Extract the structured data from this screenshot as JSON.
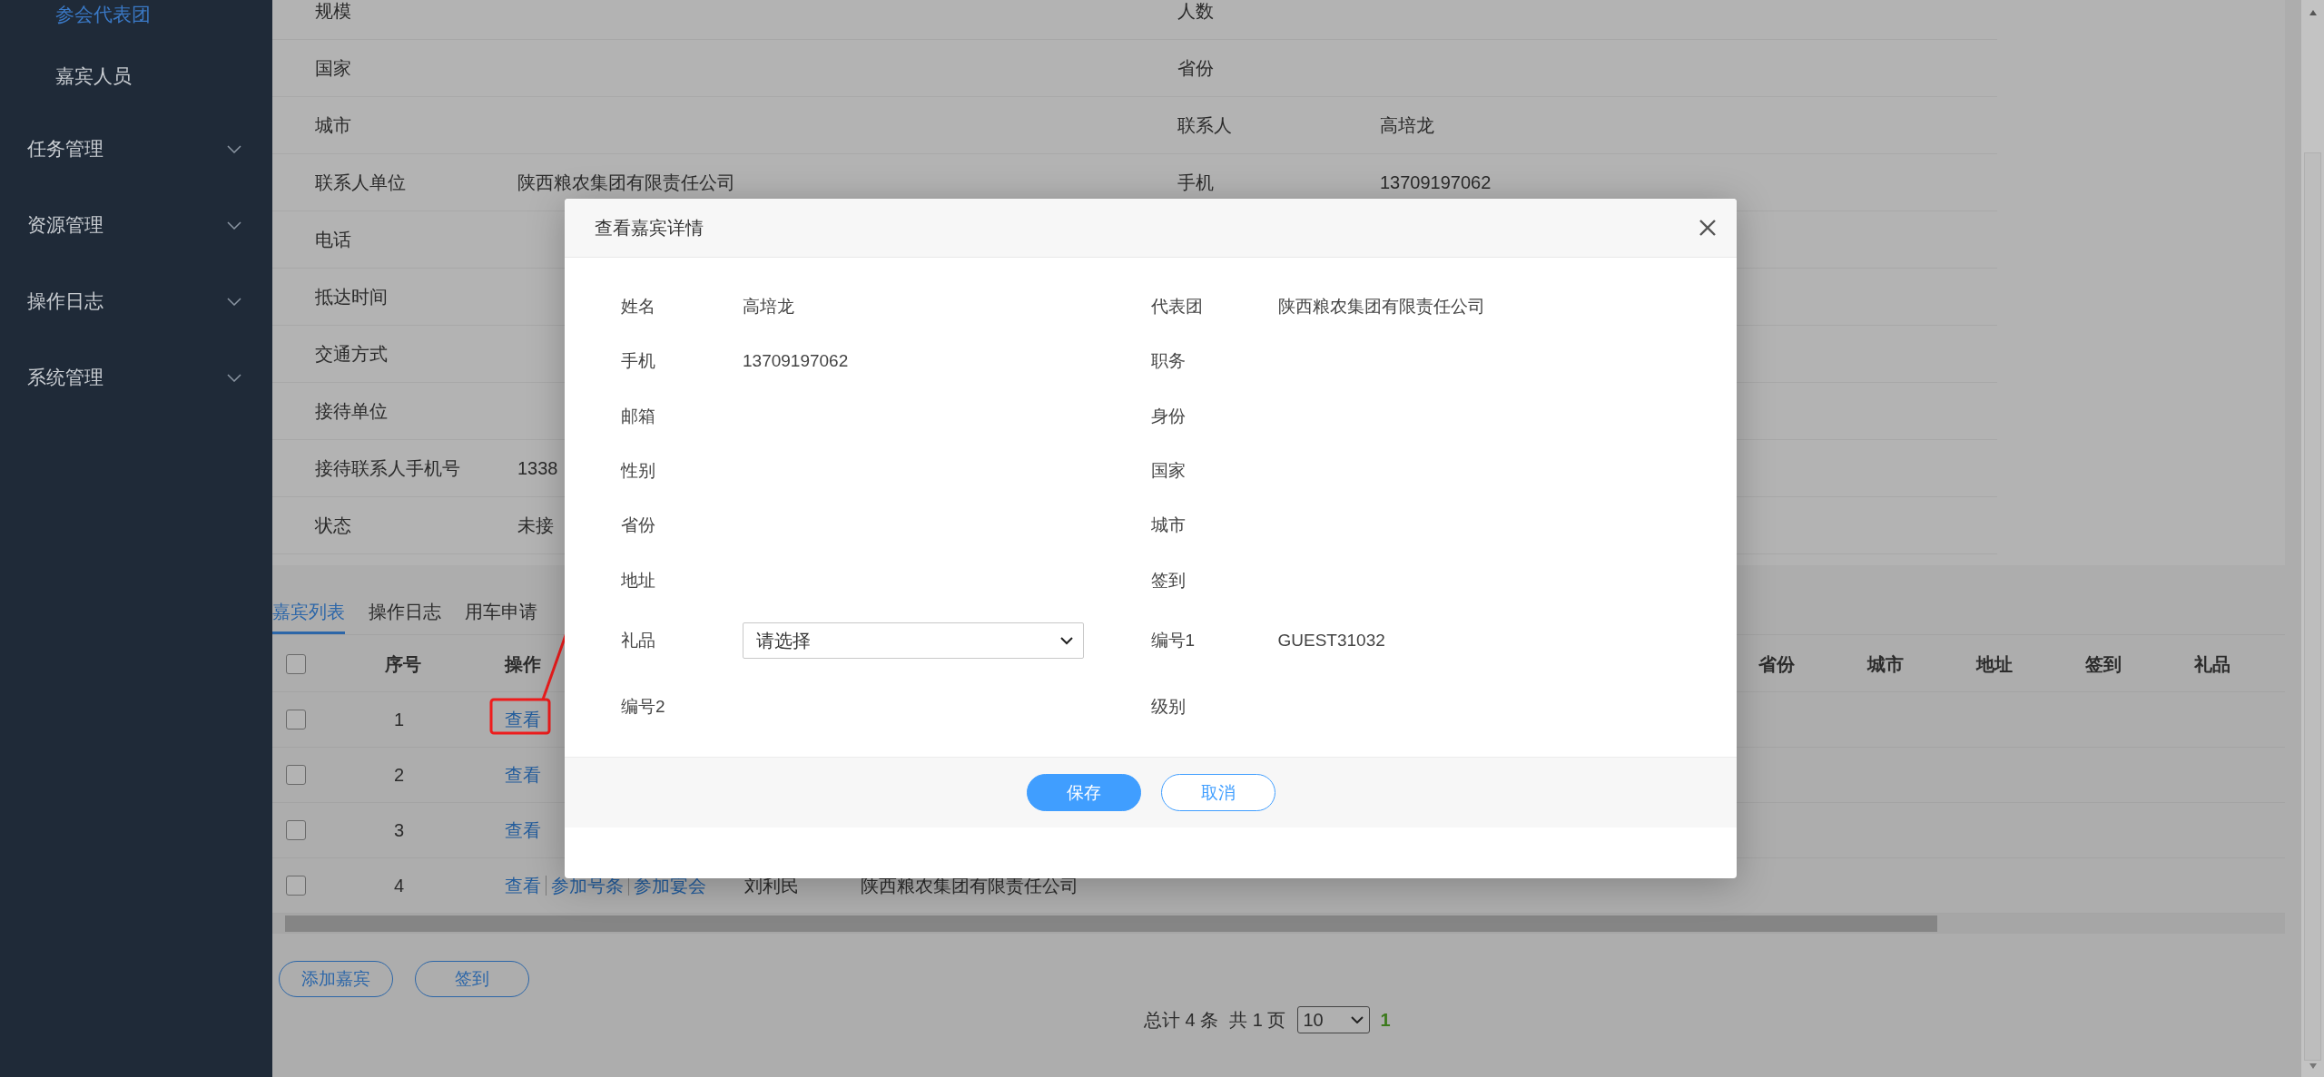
{
  "sidebar": {
    "items": [
      {
        "label": "参会代表团",
        "kind": "sub",
        "selected": true
      },
      {
        "label": "嘉宾人员",
        "kind": "sub",
        "selected": false
      },
      {
        "label": "任务管理",
        "kind": "group",
        "expanded": false
      },
      {
        "label": "资源管理",
        "kind": "group",
        "expanded": false
      },
      {
        "label": "操作日志",
        "kind": "group",
        "expanded": false
      },
      {
        "label": "系统管理",
        "kind": "group",
        "expanded": false
      }
    ]
  },
  "info_table": {
    "rows": [
      {
        "left": {
          "label": "规模"
        },
        "right": {
          "label": "人数"
        }
      },
      {
        "left": {
          "label": "国家"
        },
        "right": {
          "label": "省份"
        }
      },
      {
        "left": {
          "label": "城市"
        },
        "right": {
          "label": "联系人",
          "value": "高培龙"
        }
      },
      {
        "left": {
          "label": "联系人单位",
          "value": "陕西粮农集团有限责任公司"
        },
        "right": {
          "label": "手机",
          "value": "13709197062"
        }
      },
      {
        "left": {
          "label": "电话"
        }
      },
      {
        "left": {
          "label": "抵达时间"
        }
      },
      {
        "left": {
          "label": "交通方式"
        }
      },
      {
        "left": {
          "label": "接待单位"
        }
      },
      {
        "left": {
          "label": "接待联系人手机号",
          "value": "1338"
        }
      },
      {
        "left": {
          "label": "状态",
          "value": "未接"
        }
      }
    ]
  },
  "tabs": [
    {
      "label": "嘉宾列表",
      "selected": true
    },
    {
      "label": "操作日志",
      "selected": false
    },
    {
      "label": "用车申请",
      "selected": false
    }
  ],
  "guest_table": {
    "select_all_checked": false,
    "columns_left": [
      "序号",
      "操作"
    ],
    "columns_right": [
      "省份",
      "城市",
      "地址",
      "签到",
      "礼品"
    ],
    "rows": [
      {
        "index": "1",
        "checked": false,
        "actions": [
          "查看"
        ]
      },
      {
        "index": "2",
        "checked": false,
        "actions": [
          "查看"
        ]
      },
      {
        "index": "3",
        "checked": false,
        "actions": [
          "查看"
        ]
      },
      {
        "index": "4",
        "checked": false,
        "actions": [
          "查看",
          "参加号条",
          "参加宴会"
        ],
        "name": "刘利民",
        "delegation": "陕西粮农集团有限责任公司"
      }
    ]
  },
  "buttons": [
    "添加嘉宾",
    "签到"
  ],
  "pagination": {
    "total": "总计 4 条",
    "pages": "共 1 页",
    "page_size": "10",
    "current": "1"
  },
  "dialog": {
    "title": "查看嘉宾详情",
    "fields": [
      {
        "label": "姓名",
        "value": "高培龙"
      },
      {
        "label": "代表团",
        "value": "陕西粮农集团有限责任公司"
      },
      {
        "label": "手机",
        "value": "13709197062"
      },
      {
        "label": "职务"
      },
      {
        "label": "邮箱"
      },
      {
        "label": "身份"
      },
      {
        "label": "性别"
      },
      {
        "label": "国家"
      },
      {
        "label": "省份"
      },
      {
        "label": "城市"
      },
      {
        "label": "地址"
      },
      {
        "label": "签到"
      },
      {
        "label": "礼品",
        "kind": "select",
        "placeholder": "请选择"
      },
      {
        "label": "编号1",
        "value": "GUEST31032"
      },
      {
        "label": "编号2"
      },
      {
        "label": "级别"
      }
    ],
    "buttons": [
      {
        "label": "保存",
        "kind": "primary"
      },
      {
        "label": "取消",
        "kind": "secondary"
      }
    ]
  }
}
